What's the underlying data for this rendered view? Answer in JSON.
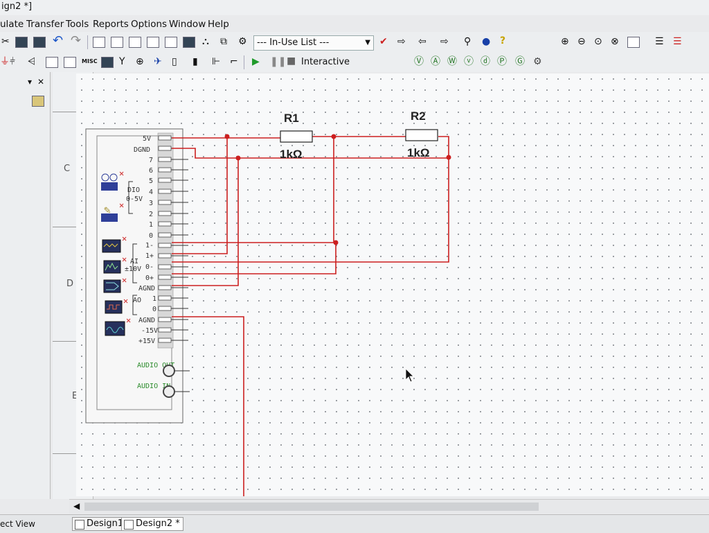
{
  "window": {
    "title": "ign2 *]"
  },
  "menu": [
    "ulate",
    "Transfer",
    "Tools",
    "Reports",
    "Options",
    "Window",
    "Help"
  ],
  "toolbar": {
    "in_use_list": "--- In-Use List ---",
    "misc_label": "MISC",
    "simulation_mode": "Interactive"
  },
  "ruler": {
    "rows": [
      "C",
      "D",
      "E"
    ]
  },
  "schematic": {
    "components": [
      {
        "ref": "R1",
        "value": "1kΩ"
      },
      {
        "ref": "R2",
        "value": "1kΩ"
      }
    ],
    "myDAQ": {
      "pins_top": [
        "5V",
        "DGND"
      ],
      "dio_pins": [
        "7",
        "6",
        "5",
        "4",
        "3",
        "2",
        "1",
        "0"
      ],
      "dio_label": "DIO",
      "dio_range": "0-5V",
      "ai_pins": [
        "1-",
        "1+",
        "0-",
        "0+",
        "AGND"
      ],
      "ai_label": "AI",
      "ai_range": "±10V",
      "ao_pins": [
        "1",
        "0",
        "AGND"
      ],
      "ao_label": "AO",
      "power_pins": [
        "-15V",
        "+15V"
      ],
      "audio": [
        "AUDIO OUT",
        "AUDIO IN"
      ]
    },
    "colors": {
      "wire": "#cc1f1f",
      "grid_dot": "#8b8f95",
      "canvas": "#f8f9fa"
    }
  },
  "status": {
    "left_view": "ect View",
    "tabs": [
      "Design1",
      "Design2 *"
    ]
  }
}
